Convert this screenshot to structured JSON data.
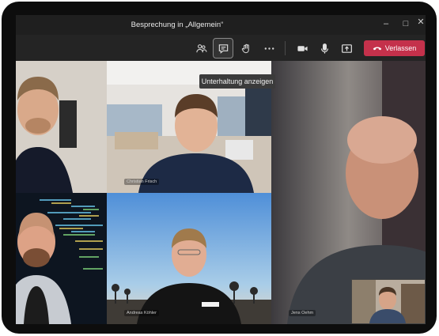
{
  "window": {
    "title": "Besprechung in „Allgemein“",
    "controls": [
      "minimize-icon",
      "maximize-icon",
      "close-icon"
    ]
  },
  "toolbar": {
    "buttons": [
      {
        "icon": "people-icon",
        "label": "Teilnehmer"
      },
      {
        "icon": "chat-icon",
        "label": "Unterhaltung anzeigen",
        "active": true
      },
      {
        "icon": "raise-hand-icon",
        "label": "Hand heben"
      },
      {
        "icon": "more-icon",
        "label": "Weitere Aktionen"
      },
      {
        "icon": "camera-icon",
        "label": "Kamera"
      },
      {
        "icon": "mic-icon",
        "label": "Mikrofon"
      },
      {
        "icon": "share-icon",
        "label": "Freigeben"
      }
    ],
    "leave_label": "Verlassen"
  },
  "tooltip": "Unterhaltung anzeigen",
  "participants": [
    {
      "name": "",
      "position": "top-left"
    },
    {
      "name": "Christian Frisch",
      "position": "top-center"
    },
    {
      "name": "",
      "position": "middle-left"
    },
    {
      "name": "Andreas Köhler",
      "position": "bottom-center"
    },
    {
      "name": "Jens Oehm",
      "position": "right"
    }
  ],
  "colors": {
    "background": "#1f1f1f",
    "toolbar": "#242424",
    "leave_button": "#c4314b"
  }
}
